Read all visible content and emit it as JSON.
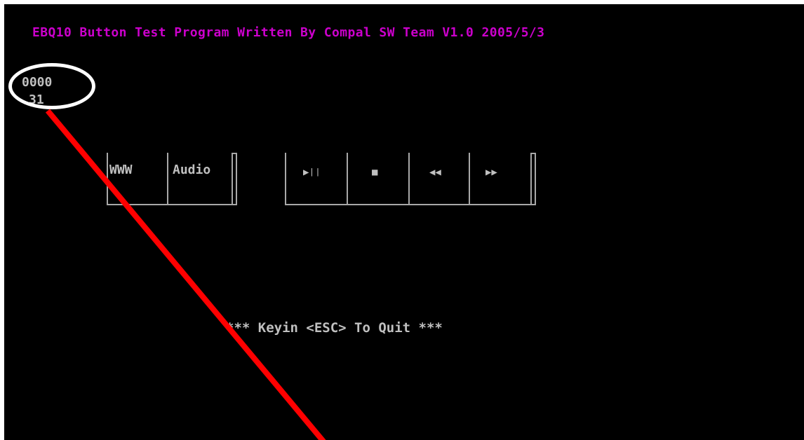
{
  "header": {
    "title": "EBQ10 Button Test Program Written By Compal SW Team V1.0 2005/5/3"
  },
  "readout": {
    "code": "0000",
    "scan": "31"
  },
  "button_groups": [
    {
      "buttons": [
        {
          "label": "WWW"
        },
        {
          "label": "Audio"
        }
      ]
    },
    {
      "buttons": [
        {
          "label": "▶❘❘",
          "icon": "play-pause-icon"
        },
        {
          "label": "■",
          "icon": "stop-icon"
        },
        {
          "label": "◀◀",
          "icon": "rewind-icon"
        },
        {
          "label": "▶▶",
          "icon": "fast-forward-icon"
        }
      ]
    }
  ],
  "footer": {
    "quit_text": "*** Keyin <ESC> To Quit ***"
  },
  "colors": {
    "title": "#cc00cc",
    "text": "#c0c0c0",
    "background": "#000000",
    "annotation_circle": "#ffffff",
    "annotation_arrow": "#ff0000"
  }
}
